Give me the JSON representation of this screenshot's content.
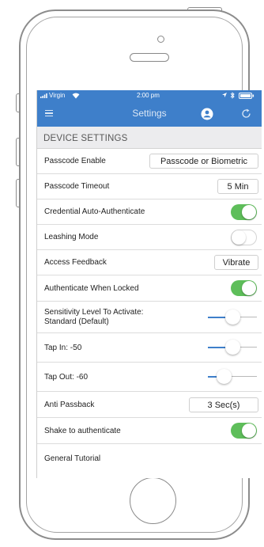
{
  "status_bar": {
    "carrier": "Virgin",
    "time": "2:00 pm"
  },
  "nav": {
    "title": "Settings"
  },
  "section_header": "DEVICE SETTINGS",
  "rows": {
    "passcode_enable": {
      "label": "Passcode Enable",
      "value": "Passcode or Biometric"
    },
    "passcode_timeout": {
      "label": "Passcode Timeout",
      "value": "5 Min"
    },
    "credential_auto": {
      "label": "Credential Auto-Authenticate",
      "on": true
    },
    "leashing": {
      "label": "Leashing Mode",
      "on": false
    },
    "access_feedback": {
      "label": "Access Feedback",
      "value": "Vibrate"
    },
    "auth_locked": {
      "label": "Authenticate When Locked",
      "on": true
    },
    "sensitivity": {
      "label_line1": "Sensitivity Level To Activate:",
      "label_line2": "Standard (Default)",
      "level": 0.5
    },
    "tap_in": {
      "label": "Tap In: -50",
      "level": 0.5
    },
    "tap_out": {
      "label": "Tap Out: -60",
      "level": 0.25
    },
    "anti_passback": {
      "label": "Anti Passback",
      "value": "3 Sec(s)"
    },
    "shake": {
      "label": "Shake to authenticate",
      "on": true
    },
    "tutorial": {
      "label": "General Tutorial"
    }
  },
  "colors": {
    "nav_blue": "#3e7fca",
    "toggle_on": "#5ebe5a",
    "section_bg": "#ececee"
  }
}
